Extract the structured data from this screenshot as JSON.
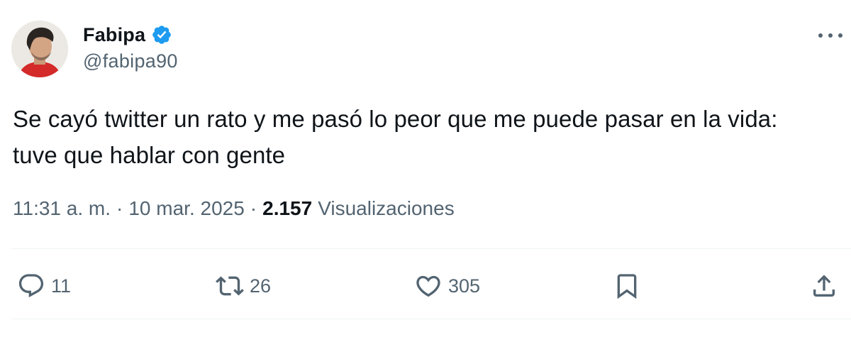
{
  "author": {
    "display_name": "Fabipa",
    "handle": "@fabipa90",
    "verified": true,
    "verified_color": "#1d9bf0"
  },
  "tweet": {
    "text_line1": "Se cayó twitter un rato y me pasó lo peor que me puede pasar en la vida:",
    "text_line2": "tuve que hablar con gente",
    "time": "11:31 a. m.",
    "separator": "·",
    "date": "10 mar. 2025",
    "views_count": "2.157",
    "views_label": "Visualizaciones"
  },
  "actions": {
    "replies": "11",
    "reposts": "26",
    "likes": "305"
  },
  "icons": {
    "more": "more-horizontal-icon",
    "reply": "reply-icon",
    "repost": "repost-icon",
    "like": "heart-icon",
    "bookmark": "bookmark-icon",
    "share": "share-icon"
  },
  "colors": {
    "text_primary": "#0f1419",
    "text_secondary": "#536471",
    "divider": "#eff3f4"
  }
}
